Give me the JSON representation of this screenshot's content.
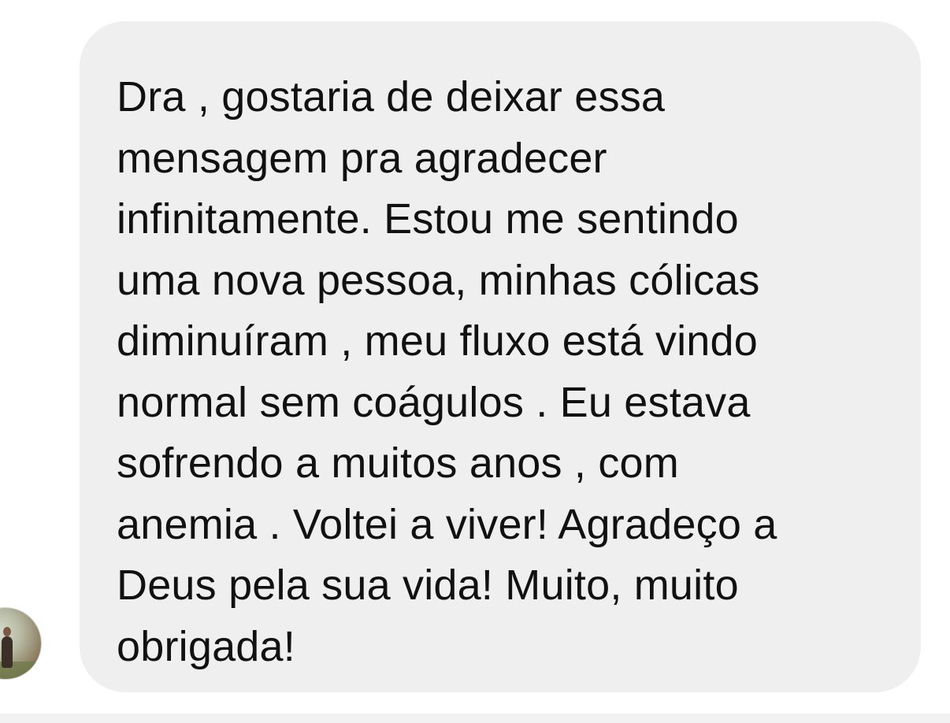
{
  "conversation": {
    "incoming_message": {
      "text": "Dra , gostaria de deixar essa\nmensagem pra agradecer\ninfinitamente. Estou me sentindo\numa nova pessoa, minhas cólicas\ndiminuíram , meu fluxo está vindo\nnormal sem coágulos . Eu estava\nsofrendo a muitos anos , com\nanemia . Voltei a viver! Agradeço a\nDeus pela sua vida! Muito, muito\nobrigada!"
    },
    "sender_avatar": {
      "icon": "avatar-photo"
    }
  },
  "colors": {
    "bubble_background": "#efefef",
    "text": "#111111",
    "page_background": "#ffffff",
    "bottom_strip": "#f2f2f2"
  }
}
